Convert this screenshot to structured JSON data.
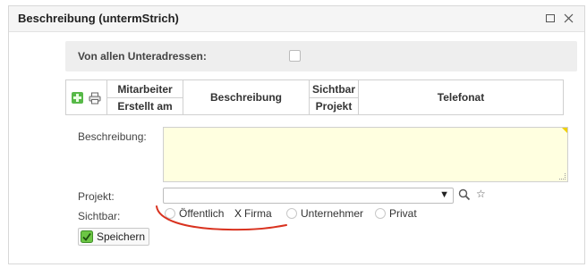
{
  "panel": {
    "title": "Beschreibung (untermStrich)",
    "icons": [
      "maximize-icon",
      "close-icon"
    ]
  },
  "filter": {
    "label": "Von allen Unteradressen:",
    "checked": false
  },
  "grid": {
    "col_mitarbeiter": "Mitarbeiter",
    "col_erstellt": "Erstellt am",
    "col_beschreibung": "Beschreibung",
    "col_sichtbar": "Sichtbar",
    "col_projekt": "Projekt",
    "col_telefonat": "Telefonat",
    "icons": [
      "add-icon",
      "print-icon"
    ]
  },
  "form": {
    "beschreibung_label": "Beschreibung:",
    "beschreibung_value": "",
    "projekt_label": "Projekt:",
    "projekt_value": "",
    "sichtbar_label": "Sichtbar:",
    "sichtbar_options": [
      "Öffentlich",
      "Firma",
      "Unternehmer",
      "Privat"
    ],
    "sichtbar_selected": "Firma",
    "save_label": "Speichern"
  },
  "colors": {
    "textarea_bg": "#ffffe0",
    "annotation_stroke": "#d9321f",
    "add_green": "#57b948"
  }
}
